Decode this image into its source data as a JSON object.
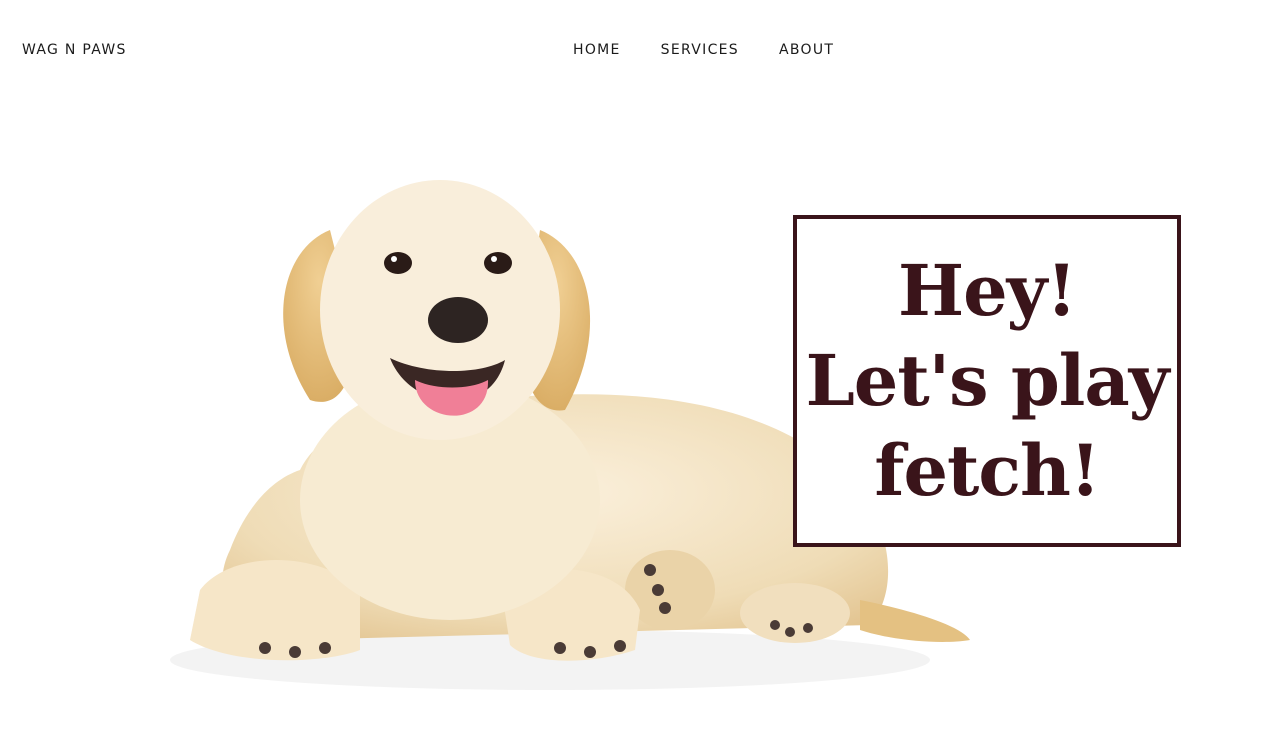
{
  "header": {
    "brand": "WAG N PAWS",
    "nav": [
      {
        "label": "HOME"
      },
      {
        "label": "SERVICES"
      },
      {
        "label": "ABOUT"
      }
    ]
  },
  "hero": {
    "headline_lines": [
      "Hey!",
      "Let's play",
      "fetch!"
    ],
    "colors": {
      "accent": "#3a141a",
      "background": "#ffffff"
    }
  }
}
